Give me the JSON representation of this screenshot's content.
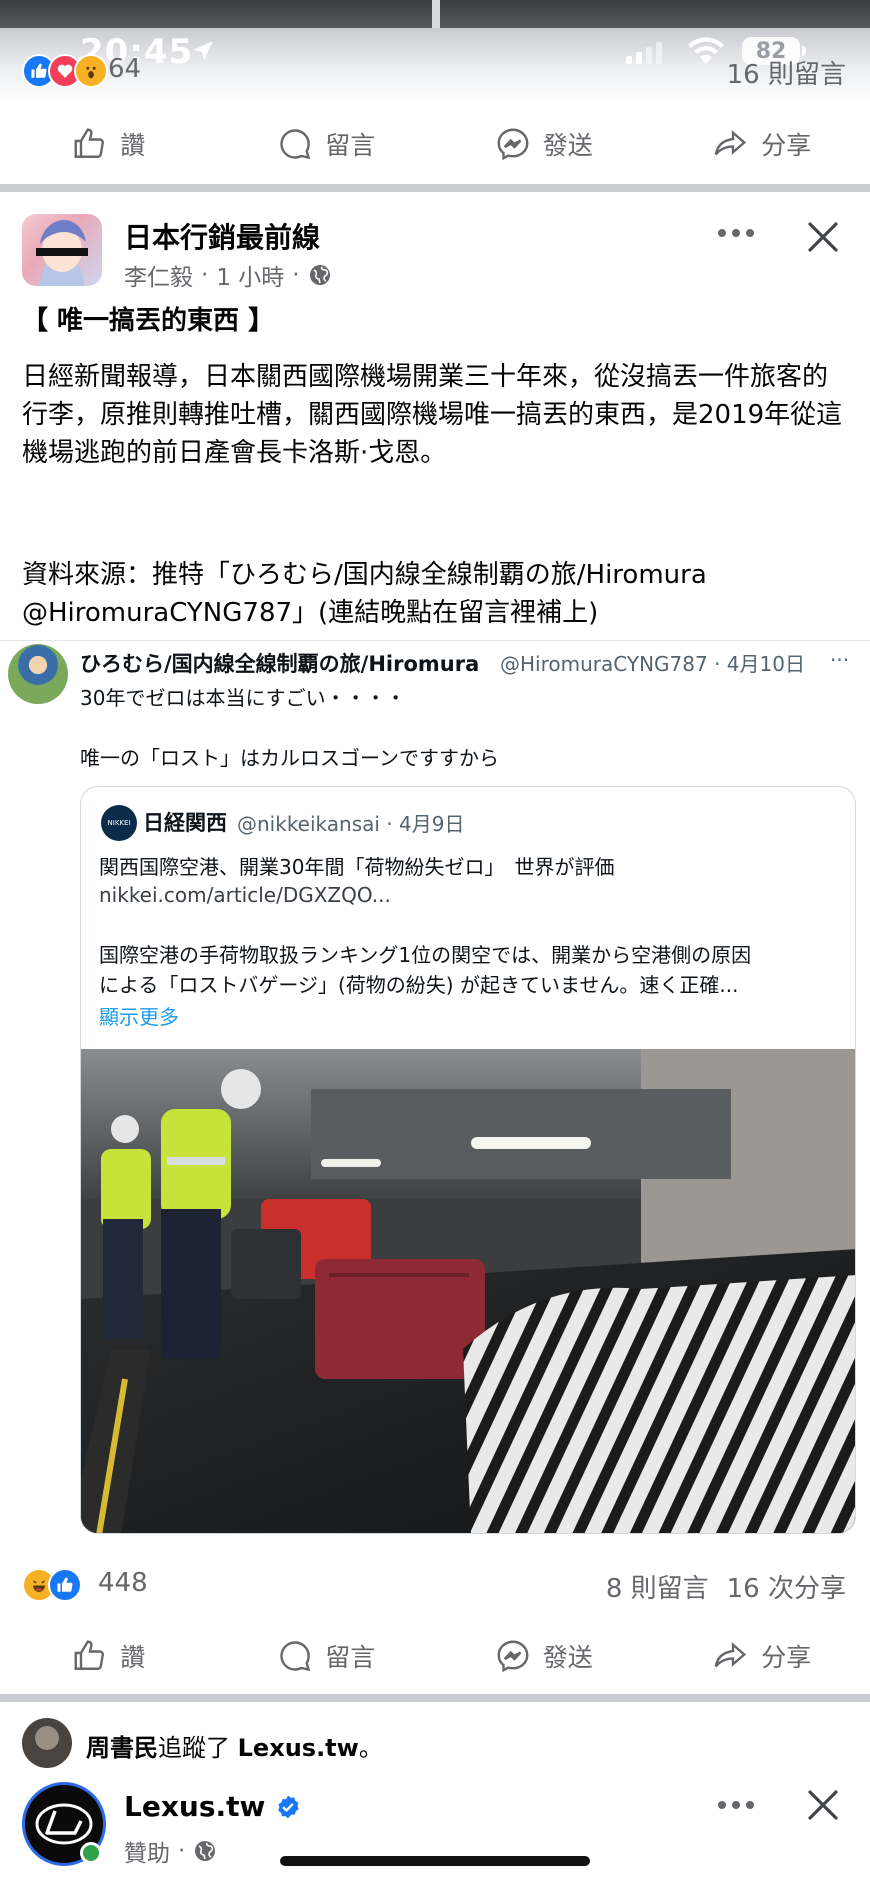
{
  "status_bar": {
    "time": "20:45",
    "battery": "82"
  },
  "top_post": {
    "reaction_count": "64",
    "comments": "16 則留言"
  },
  "actions": {
    "like": "讚",
    "comment": "留言",
    "send": "發送",
    "share": "分享"
  },
  "post": {
    "page_name": "日本行銷最前線",
    "author": "李仁毅",
    "time": "1 小時",
    "title": "【 唯一搞丟的東西 】",
    "body": "日經新聞報導，日本關西國際機場開業三十年來，從沒搞丟一件旅客的行李，原推則轉推吐槽，關西國際機場唯一搞丟的東西，是2019年從這機場逃跑的前日產會長卡洛斯·戈恩。",
    "source": "資料來源：推特「ひろむら/国内線全線制覇の旅/Hiromura @HiromuraCYNG787」(連結晚點在留言裡補上)",
    "reaction_count": "448",
    "comments": "8 則留言",
    "shares": "16 次分享"
  },
  "tweet": {
    "name": "ひろむら/国内線全線制覇の旅/Hiromura",
    "handle": "@HiromuraCYNG787 · 4月10日",
    "more": "···",
    "line1": "30年でゼロは本当にすごい・・・・",
    "line2": "唯一の「ロスト」はカルロスゴーンですすから",
    "quote": {
      "name": "日経関西",
      "handle": "@nikkeikansai · 4月9日",
      "headline": "関西国際空港、開業30年間「荷物紛失ゼロ」　世界が評価",
      "link": "nikkei.com/article/DGXZQO...",
      "text1": "国際空港の手荷物取扱ランキング1位の関空では、開業から空港側の原因",
      "text2": "による「ロストバゲージ」(荷物の紛失) が起きていません。速く正確...",
      "show_more": "顯示更多"
    }
  },
  "next_story": {
    "follower": "周書民",
    "follow_text": "追蹤了",
    "followed_page": "Lexus.tw",
    "page_name": "Lexus.tw",
    "sponsored": "贊助"
  },
  "colors": {
    "accent": "#1877f2",
    "twitter_blue": "#1d9bf0",
    "meta_gray": "#65676b"
  }
}
